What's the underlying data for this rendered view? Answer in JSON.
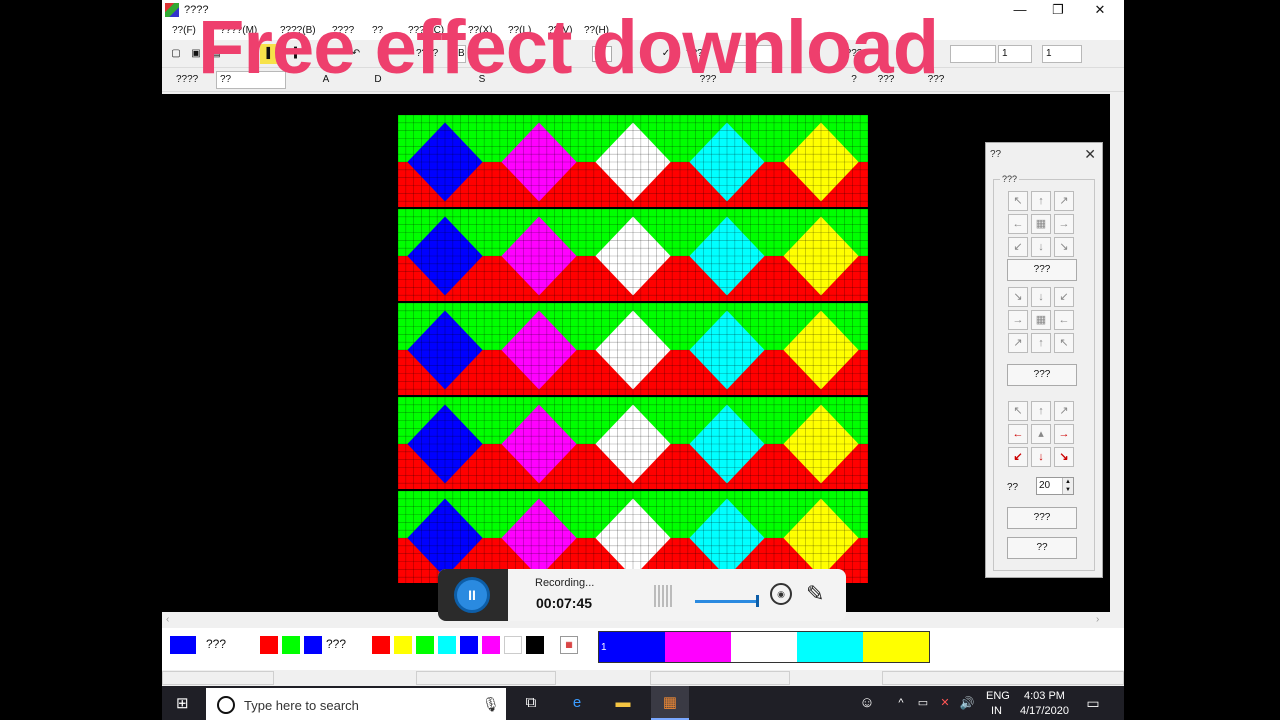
{
  "window": {
    "title": "????",
    "minimize": "—",
    "maximize": "❐",
    "close": "✕"
  },
  "menu": [
    "??(F)",
    "????(M)",
    "????(B)",
    "????",
    "??",
    "????(C)",
    "??(X)",
    "??(L)",
    "??(V)",
    "??(H)"
  ],
  "toolbar1": {
    "buttons": [
      "▢",
      "▣",
      "▤",
      "▌",
      "▍",
      "↶",
      "↷",
      "????",
      "?",
      "▼",
      "✓",
      "????",
      "???",
      "???"
    ],
    "fields": [
      "B",
      "",
      "",
      "1",
      "1"
    ]
  },
  "toolbar2": {
    "field": "????",
    "select": "??",
    "buttons": [
      "A",
      "D",
      "S",
      "???",
      "?",
      "???",
      "???"
    ]
  },
  "overlay": {
    "title": "Free effect download"
  },
  "pattern": {
    "background": "#ff0000",
    "band_color": "#00ff00",
    "diamond_colors": [
      "#0000ff",
      "#ff00ff",
      "#ffffff",
      "#00ffff",
      "#ffff00"
    ],
    "rows": 5
  },
  "tool_panel": {
    "title": "??",
    "close": "✕",
    "group_label": "???",
    "buttons": [
      "???",
      "???",
      "???",
      "??"
    ],
    "step_label": "??",
    "step_value": "20"
  },
  "bottom_panel": {
    "label1": "???",
    "label2": "???",
    "palette": [
      "#ff0000",
      "#ffff00",
      "#00ff00",
      "#00ffff",
      "#0000ff",
      "#ff00ff",
      "#ffffff",
      "#000000"
    ],
    "strip_number": "1",
    "strip_colors": [
      "#0000ff",
      "#ff00ff",
      "#ffffff",
      "#00ffff",
      "#ffff00"
    ]
  },
  "recorder": {
    "status": "Recording...",
    "time": "00:07:45"
  },
  "taskbar": {
    "search_placeholder": "Type here to search",
    "lang_top": "ENG",
    "lang_bottom": "IN",
    "time": "4:03 PM",
    "date": "4/17/2020"
  }
}
